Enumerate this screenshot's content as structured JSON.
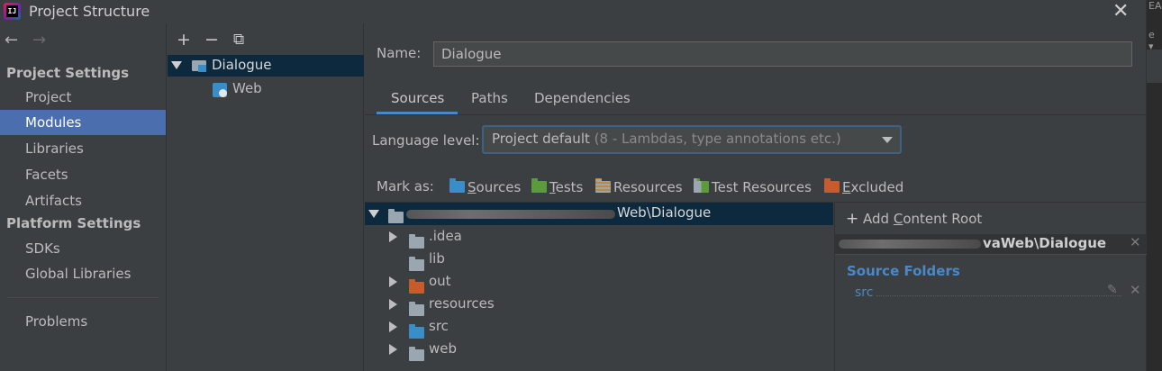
{
  "window": {
    "title": "Project Structure",
    "close_glyph": "✕",
    "app_icon_text": "IJ"
  },
  "background_window": {
    "text_top": "EA",
    "text_mid": "e ▾"
  },
  "nav": {
    "back_glyph": "←",
    "forward_glyph": "→",
    "sections": [
      {
        "heading": "Project Settings",
        "items": [
          "Project",
          "Modules",
          "Libraries",
          "Facets",
          "Artifacts"
        ]
      },
      {
        "heading": "Platform Settings",
        "items": [
          "SDKs",
          "Global Libraries"
        ]
      }
    ],
    "problems": "Problems",
    "selected": "Modules"
  },
  "module_toolbar": {
    "add": "+",
    "remove": "−",
    "copy": "⧉"
  },
  "modules": [
    {
      "name": "Dialogue",
      "icon": "module-folder-icon",
      "expanded": true
    },
    {
      "name": "Web",
      "icon": "web-facet-icon"
    }
  ],
  "name_field": {
    "label": "Name:",
    "value": "Dialogue"
  },
  "tabs": [
    "Sources",
    "Paths",
    "Dependencies"
  ],
  "active_tab": "Sources",
  "language_level": {
    "label": "Language level:",
    "value": "Project default",
    "hint": "(8 - Lambdas, type annotations etc.)"
  },
  "mark_as": {
    "label": "Mark as:",
    "options": [
      {
        "label": "Sources",
        "mnemonic": "S",
        "rest": "ources",
        "color": "#3a8ec7",
        "icon": "sources-folder-icon"
      },
      {
        "label": "Tests",
        "mnemonic": "T",
        "rest": "ests",
        "color": "#5c9b3a",
        "icon": "tests-folder-icon"
      },
      {
        "label": "Resources",
        "mnemonic": "",
        "rest": "Resources",
        "color": "#9aa7b0",
        "icon": "resources-folder-icon"
      },
      {
        "label": "Test Resources",
        "mnemonic": "",
        "rest": "Test Resources",
        "color": "#9aa7b0",
        "icon": "test-resources-folder-icon"
      },
      {
        "label": "Excluded",
        "mnemonic": "E",
        "rest": "xcluded",
        "color": "#c85b2c",
        "icon": "excluded-folder-icon"
      }
    ]
  },
  "tree": {
    "root_path_visible": "Web\\Dialogue",
    "children": [
      {
        "name": ".idea",
        "expandable": true,
        "color": "#9aa7b0"
      },
      {
        "name": "lib",
        "expandable": false,
        "color": "#9aa7b0"
      },
      {
        "name": "out",
        "expandable": true,
        "color": "#c85b2c"
      },
      {
        "name": "resources",
        "expandable": true,
        "color": "#9aa7b0"
      },
      {
        "name": "src",
        "expandable": true,
        "color": "#3a8ec7"
      },
      {
        "name": "web",
        "expandable": true,
        "color": "#9aa7b0"
      }
    ]
  },
  "content_root": {
    "add_label": "Add Content Root",
    "add_mnemonic": "C",
    "path_visible": "vaWeb\\Dialogue",
    "source_folders_heading": "Source Folders",
    "source_folders": [
      "src"
    ]
  }
}
